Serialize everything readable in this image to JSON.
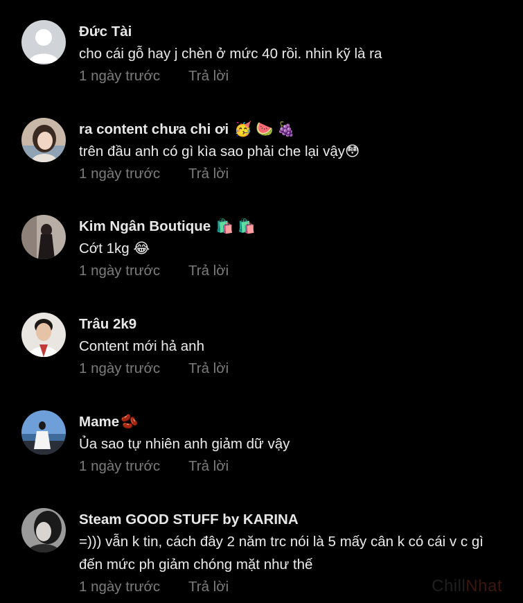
{
  "comments": [
    {
      "name": "Đức Tài",
      "name_emoji": "",
      "text": "cho cái gỗ hay j chèn ở mức 40 rồi. nhin kỹ là ra",
      "time": "1 ngày trước",
      "reply": "Trả lời",
      "avatar_icon": "default-avatar-icon"
    },
    {
      "name": "ra content chưa chi ơi",
      "name_emoji": "🥳 🍉 🍇",
      "text": "trên đầu anh có gì kìa sao phải che lại vậy😳",
      "time": "1 ngày trước",
      "reply": "Trả lời",
      "avatar_icon": "user-photo-icon"
    },
    {
      "name": "Kim Ngân Boutique",
      "name_emoji": "🛍️ 🛍️",
      "text": "Cớt 1kg 😂",
      "time": "1 ngày trước",
      "reply": "Trả lời",
      "avatar_icon": "user-photo-icon"
    },
    {
      "name": "Trâu 2k9",
      "name_emoji": "",
      "text": "Content mới hả anh",
      "time": "1 ngày trước",
      "reply": "Trả lời",
      "avatar_icon": "user-photo-icon"
    },
    {
      "name": "Mame",
      "name_emoji": "🫘",
      "text": "Ủa sao tự nhiên anh giảm dữ vậy",
      "time": "1 ngày trước",
      "reply": "Trả lời",
      "avatar_icon": "user-photo-icon"
    },
    {
      "name": "Steam GOOD STUFF by KARINA",
      "name_emoji": "",
      "text": "=))) vẫn k tin, cách đây 2 năm trc nói là 5 mấy cân k có cái v c gì đến mức ph giảm chóng mặt như thế",
      "time": "1 ngày trước",
      "reply": "Trả lời",
      "avatar_icon": "user-photo-icon"
    }
  ],
  "watermark": {
    "part1": "Chill",
    "part2": "Nhat"
  },
  "colors": {
    "background": "#000000",
    "name": "#e8e8e8",
    "text": "#ececec",
    "meta": "#7c7c7c"
  }
}
